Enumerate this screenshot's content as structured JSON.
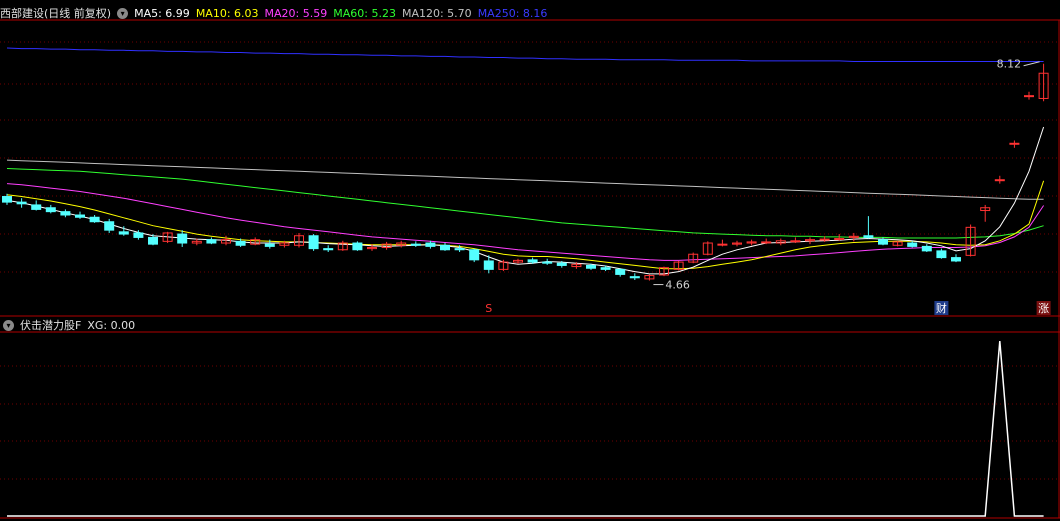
{
  "main_header": {
    "title": "西部建设(日线 前复权)",
    "ma": [
      {
        "label": "MA5: 6.99",
        "color": "#ffffff"
      },
      {
        "label": "MA10: 6.03",
        "color": "#ffff00"
      },
      {
        "label": "MA20: 5.59",
        "color": "#ff40ff"
      },
      {
        "label": "MA60: 5.23",
        "color": "#30ff30"
      },
      {
        "label": "MA120: 5.70",
        "color": "#c0c0c0"
      },
      {
        "label": "MA250: 8.16",
        "color": "#3030ff"
      }
    ]
  },
  "sub_header": {
    "title": "伏击潜力股F",
    "value_label": "XG: 0.00"
  },
  "colors": {
    "up": "#ff3232",
    "down": "#54ffff",
    "ma5": "#ffffff",
    "ma10": "#ffff00",
    "ma20": "#ff40ff",
    "ma60": "#30ff30",
    "ma120": "#c0c0c0",
    "ma250": "#3030ff",
    "grid": "#700000",
    "border": "#b00000",
    "xg": "#ffffff"
  },
  "chart_data": {
    "type": "candlestick",
    "price_range": [
      3.6,
      8.9
    ],
    "high_label": "8.12",
    "low_label": "4.66",
    "markers": [
      {
        "text": "S",
        "color": "#ff3232",
        "bg": "",
        "index": 33
      },
      {
        "text": "财",
        "color": "#ffffff",
        "bg": "#1e3c8a",
        "index": 64
      },
      {
        "text": "涨",
        "color": "#ffffff",
        "bg": "#7a1010",
        "index": 71
      }
    ],
    "candles": [
      [
        5.75,
        5.8,
        5.6,
        5.65
      ],
      [
        5.65,
        5.72,
        5.55,
        5.62
      ],
      [
        5.6,
        5.68,
        5.5,
        5.52
      ],
      [
        5.55,
        5.6,
        5.45,
        5.48
      ],
      [
        5.48,
        5.52,
        5.38,
        5.42
      ],
      [
        5.42,
        5.48,
        5.35,
        5.38
      ],
      [
        5.38,
        5.42,
        5.28,
        5.3
      ],
      [
        5.3,
        5.35,
        5.1,
        5.15
      ],
      [
        5.12,
        5.22,
        5.05,
        5.08
      ],
      [
        5.1,
        5.15,
        4.98,
        5.02
      ],
      [
        5.02,
        5.08,
        4.88,
        4.9
      ],
      [
        4.95,
        5.12,
        4.92,
        5.1
      ],
      [
        5.08,
        5.15,
        4.85,
        4.92
      ],
      [
        4.92,
        5.0,
        4.88,
        4.95
      ],
      [
        4.98,
        5.02,
        4.9,
        4.92
      ],
      [
        4.92,
        5.05,
        4.88,
        4.98
      ],
      [
        4.95,
        5.0,
        4.85,
        4.88
      ],
      [
        4.9,
        5.02,
        4.88,
        4.98
      ],
      [
        4.9,
        4.98,
        4.82,
        4.86
      ],
      [
        4.88,
        4.96,
        4.84,
        4.92
      ],
      [
        4.88,
        5.1,
        4.84,
        5.05
      ],
      [
        5.05,
        5.08,
        4.78,
        4.82
      ],
      [
        4.82,
        4.88,
        4.76,
        4.8
      ],
      [
        4.8,
        4.96,
        4.78,
        4.92
      ],
      [
        4.92,
        4.95,
        4.78,
        4.8
      ],
      [
        4.82,
        4.9,
        4.78,
        4.84
      ],
      [
        4.84,
        4.94,
        4.8,
        4.9
      ],
      [
        4.88,
        4.96,
        4.84,
        4.92
      ],
      [
        4.9,
        4.95,
        4.85,
        4.88
      ],
      [
        4.92,
        4.96,
        4.82,
        4.86
      ],
      [
        4.88,
        4.92,
        4.78,
        4.8
      ],
      [
        4.82,
        4.88,
        4.76,
        4.8
      ],
      [
        4.8,
        4.82,
        4.58,
        4.62
      ],
      [
        4.6,
        4.7,
        4.38,
        4.45
      ],
      [
        4.45,
        4.62,
        4.42,
        4.58
      ],
      [
        4.58,
        4.64,
        4.55,
        4.61
      ],
      [
        4.62,
        4.66,
        4.55,
        4.58
      ],
      [
        4.58,
        4.64,
        4.53,
        4.56
      ],
      [
        4.56,
        4.6,
        4.48,
        4.52
      ],
      [
        4.5,
        4.58,
        4.46,
        4.54
      ],
      [
        4.52,
        4.55,
        4.44,
        4.47
      ],
      [
        4.48,
        4.52,
        4.42,
        4.45
      ],
      [
        4.45,
        4.47,
        4.32,
        4.36
      ],
      [
        4.32,
        4.38,
        4.26,
        4.3
      ],
      [
        4.28,
        4.36,
        4.25,
        4.34
      ],
      [
        4.35,
        4.5,
        4.33,
        4.48
      ],
      [
        4.45,
        4.6,
        4.43,
        4.58
      ],
      [
        4.58,
        4.75,
        4.56,
        4.72
      ],
      [
        4.72,
        4.95,
        4.7,
        4.92
      ],
      [
        4.9,
        4.98,
        4.86,
        4.9
      ],
      [
        4.9,
        4.96,
        4.86,
        4.92
      ],
      [
        4.92,
        4.98,
        4.88,
        4.94
      ],
      [
        4.94,
        5.0,
        4.9,
        4.94
      ],
      [
        4.92,
        5.0,
        4.88,
        4.96
      ],
      [
        4.96,
        5.02,
        4.92,
        4.96
      ],
      [
        4.96,
        5.02,
        4.9,
        4.98
      ],
      [
        4.98,
        5.04,
        4.94,
        4.99
      ],
      [
        5.0,
        5.08,
        4.96,
        5.0
      ],
      [
        5.02,
        5.1,
        4.95,
        5.04
      ],
      [
        5.05,
        5.4,
        5.0,
        5.02
      ],
      [
        4.98,
        5.02,
        4.88,
        4.9
      ],
      [
        4.88,
        4.96,
        4.86,
        4.94
      ],
      [
        4.92,
        4.96,
        4.84,
        4.86
      ],
      [
        4.86,
        4.9,
        4.76,
        4.78
      ],
      [
        4.78,
        4.82,
        4.64,
        4.66
      ],
      [
        4.66,
        4.72,
        4.58,
        4.6
      ],
      [
        4.7,
        5.25,
        4.68,
        5.2
      ],
      [
        5.5,
        5.6,
        5.3,
        5.55
      ],
      [
        6.05,
        6.12,
        5.98,
        6.05
      ],
      [
        6.7,
        6.75,
        6.62,
        6.7
      ],
      [
        7.55,
        7.62,
        7.48,
        7.55
      ],
      [
        7.5,
        8.12,
        7.45,
        7.95
      ]
    ],
    "ma5": [
      5.68,
      5.64,
      5.58,
      5.52,
      5.46,
      5.4,
      5.34,
      5.26,
      5.18,
      5.11,
      5.05,
      5.03,
      5.01,
      4.99,
      4.98,
      4.97,
      4.94,
      4.92,
      4.92,
      4.92,
      4.94,
      4.93,
      4.91,
      4.9,
      4.89,
      4.87,
      4.86,
      4.87,
      4.88,
      4.89,
      4.87,
      4.84,
      4.77,
      4.67,
      4.58,
      4.54,
      4.56,
      4.59,
      4.58,
      4.56,
      4.54,
      4.51,
      4.46,
      4.41,
      4.37,
      4.37,
      4.41,
      4.49,
      4.61,
      4.72,
      4.8,
      4.86,
      4.92,
      4.93,
      4.94,
      4.95,
      4.96,
      4.97,
      4.99,
      5.0,
      4.99,
      4.98,
      4.96,
      4.92,
      4.87,
      4.78,
      4.82,
      4.96,
      5.21,
      5.63,
      6.2,
      6.99
    ],
    "ma10": [
      5.78,
      5.75,
      5.71,
      5.67,
      5.62,
      5.57,
      5.51,
      5.44,
      5.37,
      5.3,
      5.23,
      5.18,
      5.13,
      5.08,
      5.04,
      5.01,
      4.98,
      4.96,
      4.95,
      4.94,
      4.94,
      4.93,
      4.92,
      4.91,
      4.9,
      4.89,
      4.89,
      4.89,
      4.89,
      4.89,
      4.88,
      4.86,
      4.82,
      4.77,
      4.72,
      4.69,
      4.68,
      4.68,
      4.66,
      4.64,
      4.61,
      4.58,
      4.55,
      4.52,
      4.49,
      4.46,
      4.46,
      4.47,
      4.5,
      4.54,
      4.58,
      4.62,
      4.68,
      4.74,
      4.8,
      4.85,
      4.88,
      4.91,
      4.93,
      4.94,
      4.95,
      4.95,
      4.95,
      4.94,
      4.92,
      4.89,
      4.88,
      4.89,
      4.96,
      5.08,
      5.26,
      6.03
    ],
    "ma20": [
      5.98,
      5.96,
      5.93,
      5.9,
      5.87,
      5.84,
      5.8,
      5.76,
      5.72,
      5.67,
      5.62,
      5.57,
      5.52,
      5.47,
      5.42,
      5.37,
      5.33,
      5.29,
      5.25,
      5.21,
      5.18,
      5.15,
      5.12,
      5.09,
      5.06,
      5.03,
      5.01,
      4.99,
      4.97,
      4.95,
      4.93,
      4.91,
      4.89,
      4.86,
      4.83,
      4.8,
      4.78,
      4.76,
      4.74,
      4.72,
      4.7,
      4.68,
      4.66,
      4.64,
      4.62,
      4.61,
      4.61,
      4.62,
      4.63,
      4.64,
      4.65,
      4.66,
      4.67,
      4.68,
      4.69,
      4.71,
      4.73,
      4.75,
      4.77,
      4.79,
      4.81,
      4.82,
      4.83,
      4.84,
      4.84,
      4.84,
      4.85,
      4.87,
      4.93,
      5.03,
      5.2,
      5.59
    ],
    "ma60": [
      6.25,
      6.24,
      6.23,
      6.22,
      6.21,
      6.2,
      6.18,
      6.16,
      6.14,
      6.12,
      6.1,
      6.08,
      6.06,
      6.03,
      6.0,
      5.97,
      5.94,
      5.91,
      5.88,
      5.85,
      5.82,
      5.79,
      5.76,
      5.73,
      5.7,
      5.67,
      5.64,
      5.61,
      5.58,
      5.55,
      5.52,
      5.49,
      5.46,
      5.43,
      5.4,
      5.37,
      5.34,
      5.31,
      5.28,
      5.26,
      5.24,
      5.22,
      5.2,
      5.18,
      5.16,
      5.14,
      5.12,
      5.1,
      5.09,
      5.08,
      5.07,
      5.06,
      5.05,
      5.05,
      5.04,
      5.04,
      5.03,
      5.03,
      5.02,
      5.02,
      5.02,
      5.01,
      5.01,
      5.01,
      5.01,
      5.01,
      5.02,
      5.03,
      5.05,
      5.09,
      5.15,
      5.23
    ],
    "ma120": [
      6.4,
      6.39,
      6.38,
      6.37,
      6.36,
      6.35,
      6.34,
      6.33,
      6.32,
      6.31,
      6.3,
      6.29,
      6.28,
      6.27,
      6.26,
      6.25,
      6.24,
      6.23,
      6.22,
      6.21,
      6.2,
      6.19,
      6.18,
      6.17,
      6.16,
      6.15,
      6.14,
      6.13,
      6.12,
      6.11,
      6.1,
      6.09,
      6.08,
      6.07,
      6.06,
      6.05,
      6.04,
      6.03,
      6.02,
      6.01,
      6.0,
      5.99,
      5.98,
      5.97,
      5.96,
      5.95,
      5.94,
      5.93,
      5.92,
      5.91,
      5.9,
      5.89,
      5.88,
      5.87,
      5.86,
      5.85,
      5.84,
      5.83,
      5.82,
      5.81,
      5.8,
      5.79,
      5.78,
      5.77,
      5.76,
      5.75,
      5.74,
      5.73,
      5.72,
      5.71,
      5.7,
      5.7
    ],
    "ma250": [
      8.4,
      8.39,
      8.39,
      8.38,
      8.38,
      8.37,
      8.37,
      8.36,
      8.36,
      8.35,
      8.35,
      8.34,
      8.34,
      8.33,
      8.33,
      8.32,
      8.32,
      8.31,
      8.31,
      8.3,
      8.3,
      8.29,
      8.29,
      8.28,
      8.28,
      8.27,
      8.27,
      8.26,
      8.26,
      8.25,
      8.25,
      8.24,
      8.24,
      8.23,
      8.23,
      8.22,
      8.22,
      8.21,
      8.21,
      8.2,
      8.2,
      8.2,
      8.19,
      8.19,
      8.19,
      8.19,
      8.18,
      8.18,
      8.18,
      8.18,
      8.18,
      8.17,
      8.17,
      8.17,
      8.17,
      8.17,
      8.17,
      8.17,
      8.16,
      8.16,
      8.16,
      8.16,
      8.16,
      8.16,
      8.16,
      8.16,
      8.16,
      8.16,
      8.16,
      8.16,
      8.16,
      8.16
    ],
    "xg": [
      0,
      0,
      0,
      0,
      0,
      0,
      0,
      0,
      0,
      0,
      0,
      0,
      0,
      0,
      0,
      0,
      0,
      0,
      0,
      0,
      0,
      0,
      0,
      0,
      0,
      0,
      0,
      0,
      0,
      0,
      0,
      0,
      0,
      0,
      0,
      0,
      0,
      0,
      0,
      0,
      0,
      0,
      0,
      0,
      0,
      0,
      0,
      0,
      0,
      0,
      0,
      0,
      0,
      0,
      0,
      0,
      0,
      0,
      0,
      0,
      0,
      0,
      0,
      0,
      0,
      0,
      0,
      0,
      1,
      0,
      0,
      0
    ]
  }
}
